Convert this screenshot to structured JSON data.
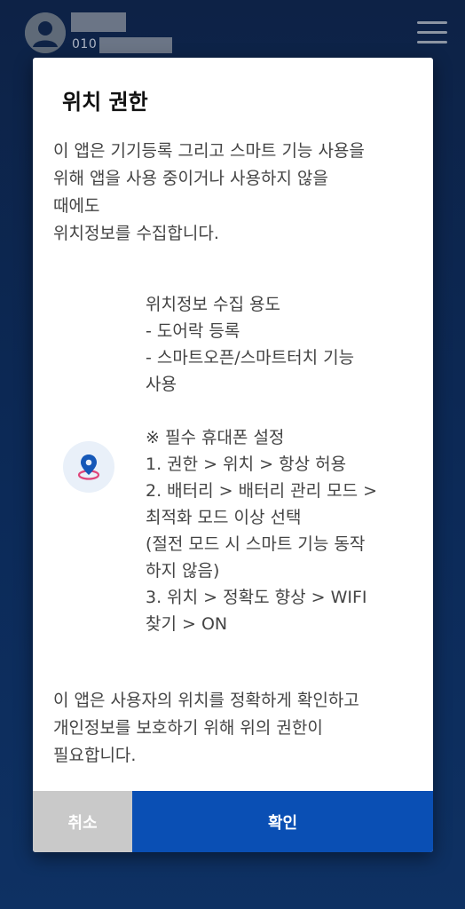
{
  "header": {
    "phone_prefix": "010",
    "icons": {
      "avatar": "user-avatar-icon",
      "menu": "hamburger-menu-icon"
    }
  },
  "dialog": {
    "title": "위치 권한",
    "intro_lines": [
      "이 앱은 기기등록 그리고 스마트 기능 사용을",
      "위해 앱을 사용 중이거나 사용하지 않을",
      "때에도",
      "위치정보를 수집합니다."
    ],
    "location_icon": "location-pin-icon",
    "purpose_lines": [
      "위치정보 수집 용도",
      "- 도어락 등록",
      "- 스마트오픈/스마트터치 기능",
      "사용"
    ],
    "settings_lines": [
      "※ 필수 휴대폰 설정",
      "1. 권한 > 위치 > 항상 허용",
      "2. 배터리 > 배터리 관리 모드 >",
      "최적화 모드 이상 선택",
      "(절전 모드 시 스마트 기능 동작",
      "하지 않음)",
      "3. 위치 > 정확도 향상 > WIFI",
      "찾기 > ON"
    ],
    "footer_lines": [
      "이 앱은 사용자의 위치를 정확하게 확인하고",
      "개인정보를 보호하기 위해 위의 권한이",
      "필요합니다."
    ],
    "cancel_label": "취소",
    "confirm_label": "확인"
  },
  "colors": {
    "background": "#0d2a55",
    "confirm_button": "#0a4fb4",
    "cancel_button": "#c9c9c9",
    "pin_blue": "#1558b8",
    "pin_ring": "#e0457b"
  }
}
